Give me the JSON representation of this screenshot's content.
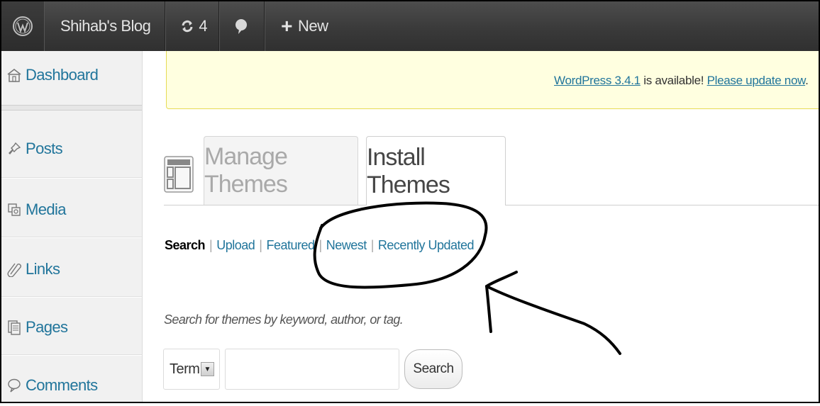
{
  "adminbar": {
    "site_name": "Shihab's Blog",
    "updates_count": "4",
    "new_label": "New"
  },
  "sidebar": {
    "items": [
      {
        "label": "Dashboard",
        "icon": "dashboard-icon"
      },
      {
        "label": "Posts",
        "icon": "pushpin-icon"
      },
      {
        "label": "Media",
        "icon": "media-icon"
      },
      {
        "label": "Links",
        "icon": "links-icon"
      },
      {
        "label": "Pages",
        "icon": "pages-icon"
      },
      {
        "label": "Comments",
        "icon": "comment-bubble-icon"
      }
    ]
  },
  "notice": {
    "version_link": "WordPress 3.4.1",
    "middle_text": " is available! ",
    "update_link": "Please update now",
    "end_text": "."
  },
  "tabs": {
    "manage": "Manage Themes",
    "install": "Install Themes",
    "active": "install"
  },
  "subnav": {
    "items": [
      "Search",
      "Upload",
      "Featured",
      "Newest",
      "Recently Updated"
    ],
    "current": "Search"
  },
  "search": {
    "description": "Search for themes by keyword, author, or tag.",
    "select_value": "Term",
    "input_value": "",
    "button_label": "Search"
  },
  "colors": {
    "link": "#21759b",
    "adminbar": "#3a3a3a",
    "notice_bg": "#ffffe0",
    "notice_border": "#e6db55",
    "annotation": "#000000"
  }
}
